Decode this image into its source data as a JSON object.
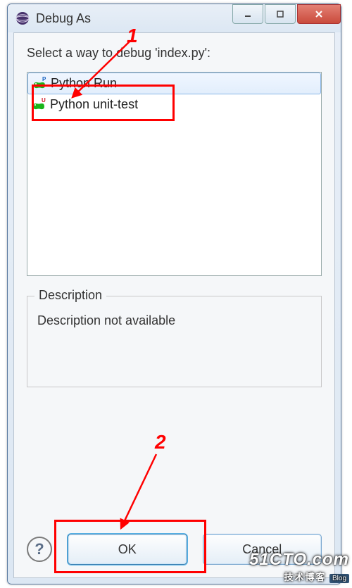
{
  "window": {
    "title": "Debug As",
    "minimize_tooltip": "Minimize",
    "maximize_tooltip": "Maximize",
    "close_tooltip": "Close"
  },
  "dialog": {
    "prompt": "Select a way to debug 'index.py':",
    "items": [
      {
        "label": "Python Run",
        "selected": true,
        "badge": "P"
      },
      {
        "label": "Python unit-test",
        "selected": false,
        "badge": "U"
      }
    ],
    "description_legend": "Description",
    "description_text": "Description not available",
    "ok_label": "OK",
    "cancel_label": "Cancel",
    "help_label": "?"
  },
  "annotations": {
    "label1": "1",
    "label2": "2"
  },
  "watermark": {
    "main": "51CTO.com",
    "sub": "技术博客",
    "tag": "Blog"
  }
}
